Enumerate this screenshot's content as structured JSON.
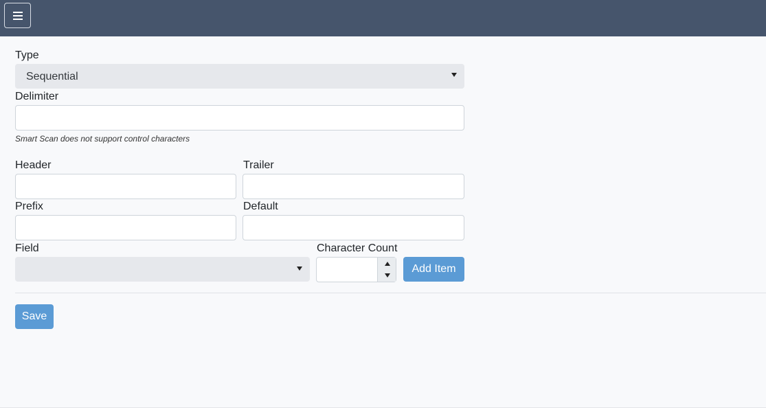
{
  "header": {
    "menu_icon": "hamburger-menu-icon"
  },
  "form": {
    "type": {
      "label": "Type",
      "selected": "Sequential"
    },
    "delimiter": {
      "label": "Delimiter",
      "value": "",
      "hint": "Smart Scan does not support control characters"
    },
    "header": {
      "label": "Header",
      "value": ""
    },
    "trailer": {
      "label": "Trailer",
      "value": ""
    },
    "prefix": {
      "label": "Prefix",
      "value": ""
    },
    "default": {
      "label": "Default",
      "value": ""
    },
    "field": {
      "label": "Field",
      "selected": ""
    },
    "character_count": {
      "label": "Character Count",
      "value": ""
    },
    "add_item_label": "Add Item",
    "save_label": "Save"
  },
  "colors": {
    "topbar": "#46556c",
    "primary": "#5b9bd5",
    "select_bg": "#e6e8ec",
    "page_bg": "#f8f9fb"
  }
}
